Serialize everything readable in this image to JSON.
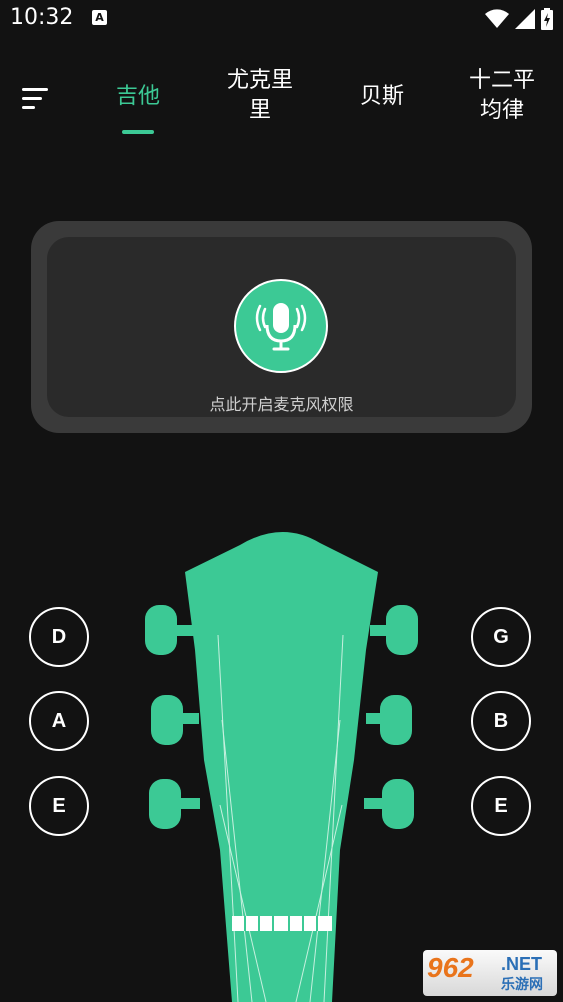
{
  "status_bar": {
    "time": "10:32",
    "notification_badge": "A"
  },
  "nav": {
    "tabs": [
      {
        "label": "吉他",
        "active": true
      },
      {
        "label1": "尤克里",
        "label2": "里"
      },
      {
        "label": "贝斯"
      },
      {
        "label1": "十二平",
        "label2": "均律"
      }
    ]
  },
  "mic": {
    "prompt": "点此开启麦克风权限"
  },
  "strings": {
    "left": [
      "D",
      "A",
      "E"
    ],
    "right": [
      "G",
      "B",
      "E"
    ]
  },
  "watermark": {
    "logo": "962",
    "net": ".NET",
    "cn": "乐游网"
  },
  "colors": {
    "accent": "#3cc995",
    "background": "#121212",
    "panel": "#3a3a3a"
  }
}
